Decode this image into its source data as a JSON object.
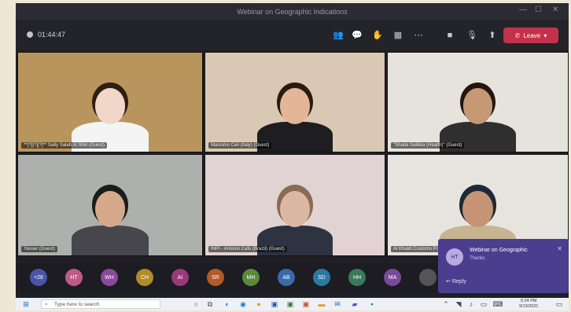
{
  "window": {
    "title": "Webinar on Geographic Indications"
  },
  "window_controls": [
    "—",
    "☐",
    "✕"
  ],
  "toolbar": {
    "timer": "01:44:47",
    "leave_label": "Leave"
  },
  "tiles": [
    {
      "name": "**[?][?][?]** Sally Salah Al Shiri (Guest)",
      "bg": "#b9955e",
      "skin": "#f1d7c7",
      "shirt": "#f4f4f4",
      "hair": "#2e1e14"
    },
    {
      "name": "Massimo Celi (Italy) (Guest)",
      "bg": "#d9c8b3",
      "skin": "#e4b596",
      "shirt": "#1d1d22",
      "hair": "#2a1b12"
    },
    {
      "name": "\"Shada Salikka (Health)\" (Guest)",
      "bg": "#e6e3dc",
      "skin": "#c79876",
      "shirt": "#2f2f2f",
      "hair": "#22160f"
    },
    {
      "name": "Yasser (Guest)",
      "bg": "#aeb0ae",
      "skin": "#d5a98a",
      "shirt": "#46464c",
      "hair": "#1c1c1c"
    },
    {
      "name": "INPI - Antonio Cafu (Brazil) (Guest)",
      "bg": "#e1d2d4",
      "skin": "#dcb7a3",
      "shirt": "#2d3340",
      "hair": "#8a6a52"
    },
    {
      "name": "Al Khaldi Customs Police",
      "bg": "#e7e4e0",
      "skin": "#c69474",
      "shirt": "#c7b591",
      "hair": "#1c2a38"
    }
  ],
  "avatars": [
    {
      "label": "+28",
      "color": "#4a55a8"
    },
    {
      "label": "HT",
      "color": "#c05a8a"
    },
    {
      "label": "WH",
      "color": "#8a4a9a"
    },
    {
      "label": "CH",
      "color": "#b08d2a"
    },
    {
      "label": "AI",
      "color": "#9a3a7a"
    },
    {
      "label": "SR",
      "color": "#b45a2a"
    },
    {
      "label": "MH",
      "color": "#5a8a3a"
    },
    {
      "label": "AB",
      "color": "#3a6aaa"
    },
    {
      "label": "SD",
      "color": "#2a7aa0"
    },
    {
      "label": "HH",
      "color": "#3a7a5a"
    },
    {
      "label": "MA",
      "color": "#7a4a9a"
    },
    {
      "label": "",
      "color": "#555"
    }
  ],
  "notification": {
    "initials": "HT",
    "title": "Webinar on Geographic",
    "subtitle": "Thanks",
    "reply": "Reply"
  },
  "taskbar": {
    "search_placeholder": "Type here to search",
    "time": "5:24 PM",
    "date": "9/13/2021"
  }
}
